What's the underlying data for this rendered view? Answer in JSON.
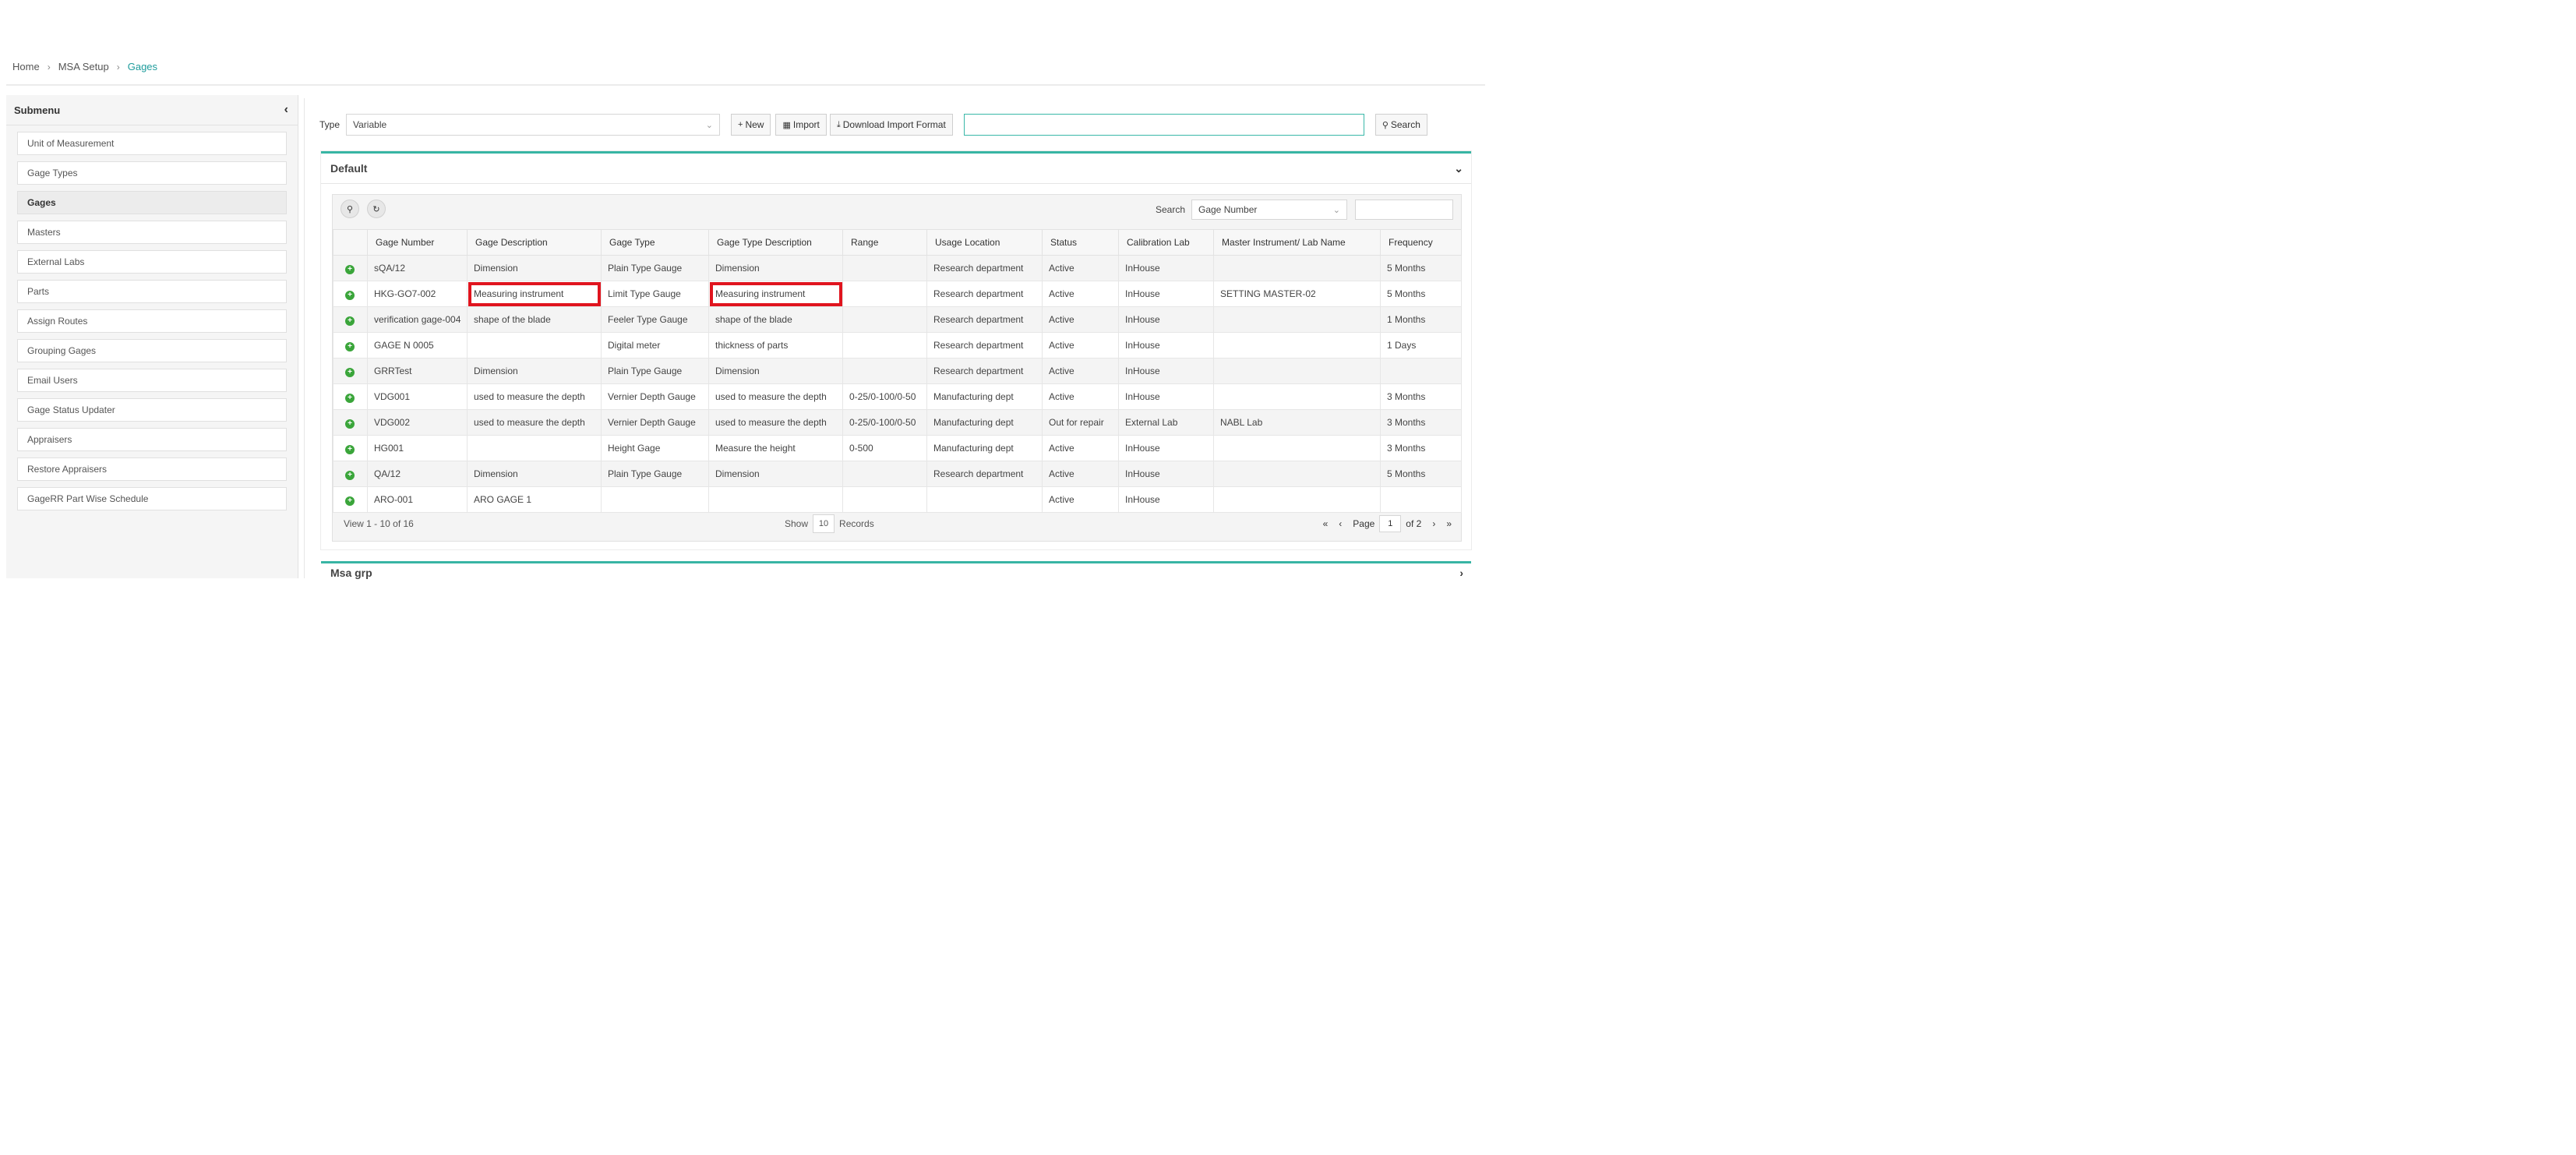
{
  "breadcrumb": {
    "items": [
      "Home",
      "MSA Setup"
    ],
    "current": "Gages"
  },
  "sidebar": {
    "title": "Submenu",
    "items": [
      {
        "label": "Unit of Measurement",
        "active": false
      },
      {
        "label": "Gage Types",
        "active": false
      },
      {
        "label": "Gages",
        "active": true
      },
      {
        "label": "Masters",
        "active": false
      },
      {
        "label": "External Labs",
        "active": false
      },
      {
        "label": "Parts",
        "active": false
      },
      {
        "label": "Assign Routes",
        "active": false
      },
      {
        "label": "Grouping Gages",
        "active": false
      },
      {
        "label": "Email Users",
        "active": false
      },
      {
        "label": "Gage Status Updater",
        "active": false
      },
      {
        "label": "Appraisers",
        "active": false
      },
      {
        "label": "Restore Appraisers",
        "active": false
      },
      {
        "label": "GageRR Part Wise Schedule",
        "active": false
      }
    ]
  },
  "toolbar": {
    "type_label": "Type",
    "type_value": "Variable",
    "new_label": "New",
    "import_label": "Import",
    "download_label": "Download Import Format",
    "search_value": "",
    "search_label": "Search"
  },
  "panel": {
    "title": "Default",
    "grid": {
      "search_label": "Search",
      "search_field": "Gage Number",
      "columns": [
        "",
        "Gage Number",
        "Gage Description",
        "Gage Type",
        "Gage Type Description",
        "Range",
        "Usage Location",
        "Status",
        "Calibration Lab",
        "Master Instrument/ Lab Name",
        "Frequency"
      ],
      "rows": [
        [
          "sQA/12",
          "Dimension",
          "Plain Type Gauge",
          "Dimension",
          "",
          "Research department",
          "Active",
          "InHouse",
          "",
          "5 Months"
        ],
        [
          "HKG-GO7-002",
          "Measuring instrument",
          "Limit Type Gauge",
          "Measuring instrument",
          "",
          "Research department",
          "Active",
          "InHouse",
          "SETTING MASTER-02",
          "5 Months"
        ],
        [
          "verification gage-004",
          "shape of the blade",
          "Feeler Type Gauge",
          "shape of the blade",
          "",
          "Research department",
          "Active",
          "InHouse",
          "",
          "1 Months"
        ],
        [
          "GAGE N 0005",
          "",
          "Digital meter",
          "thickness of parts",
          "",
          "Research department",
          "Active",
          "InHouse",
          "",
          "1 Days"
        ],
        [
          "GRRTest",
          "Dimension",
          "Plain Type Gauge",
          "Dimension",
          "",
          "Research department",
          "Active",
          "InHouse",
          "",
          ""
        ],
        [
          "VDG001",
          "used to measure the depth",
          "Vernier Depth Gauge",
          "used to measure the depth",
          "0-25/0-100/0-50",
          "Manufacturing dept",
          "Active",
          "InHouse",
          "",
          "3 Months"
        ],
        [
          "VDG002",
          "used to measure the depth",
          "Vernier Depth Gauge",
          "used to measure the depth",
          "0-25/0-100/0-50",
          "Manufacturing dept",
          "Out for repair",
          "External Lab",
          "NABL Lab",
          "3 Months"
        ],
        [
          "HG001",
          "",
          "Height Gage",
          "Measure the height",
          "0-500",
          "Manufacturing dept",
          "Active",
          "InHouse",
          "",
          "3 Months"
        ],
        [
          "QA/12",
          "Dimension",
          "Plain Type Gauge",
          "Dimension",
          "",
          "Research department",
          "Active",
          "InHouse",
          "",
          "5 Months"
        ],
        [
          "ARO-001",
          "ARO GAGE 1",
          "",
          "",
          "",
          "",
          "Active",
          "InHouse",
          "",
          ""
        ]
      ],
      "footer": {
        "view_text": "View 1 - 10 of 16",
        "show_label": "Show",
        "page_size": "10",
        "records_label": "Records",
        "page_label": "Page",
        "page_value": "1",
        "of_text": "of 2"
      }
    }
  },
  "panel2": {
    "title": "Msa grp"
  },
  "colors": {
    "accent": "#38b5a4",
    "link": "#2b8fd6",
    "highlight": "#e0141e",
    "add_icon": "#3aa53a"
  }
}
